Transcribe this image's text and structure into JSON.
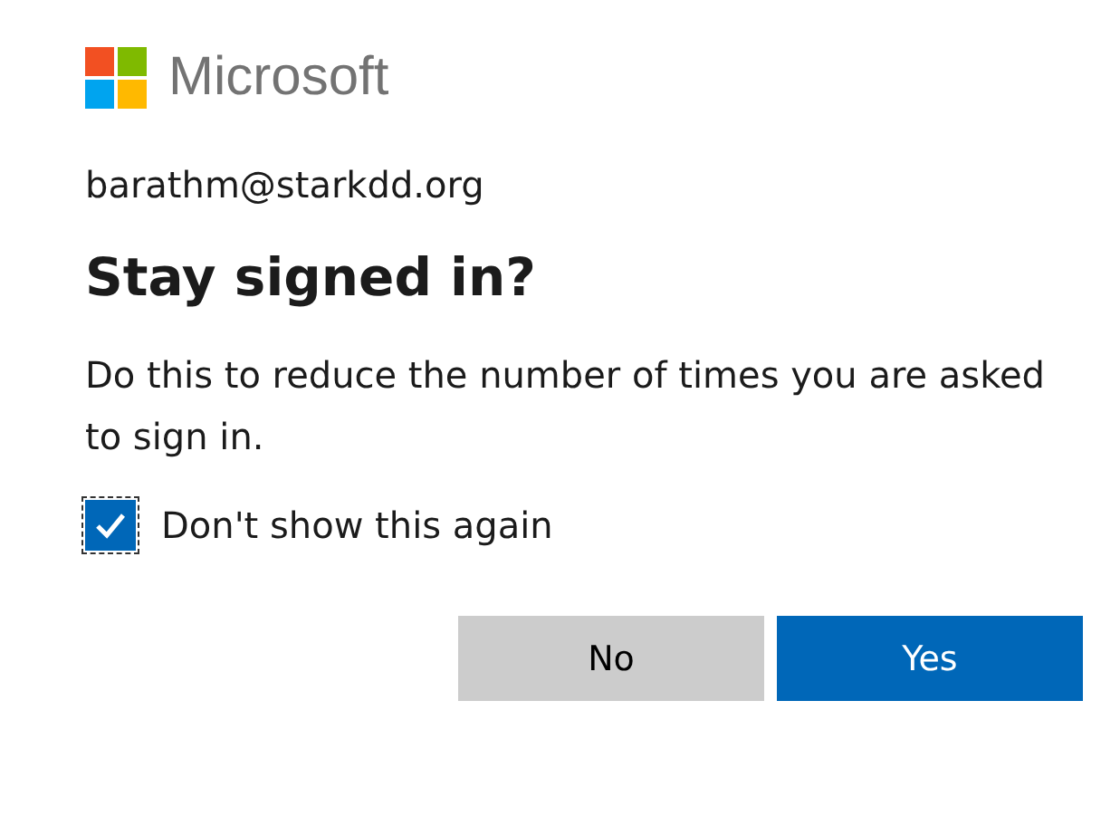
{
  "brand": {
    "name": "Microsoft"
  },
  "account": "barathm@starkdd.org",
  "heading": "Stay signed in?",
  "description": "Do this to reduce the number of times you are asked to sign in.",
  "checkbox": {
    "label": "Don't show this again",
    "checked": true
  },
  "buttons": [
    {
      "label": "No",
      "kind": "secondary"
    },
    {
      "label": "Yes",
      "kind": "primary"
    }
  ]
}
